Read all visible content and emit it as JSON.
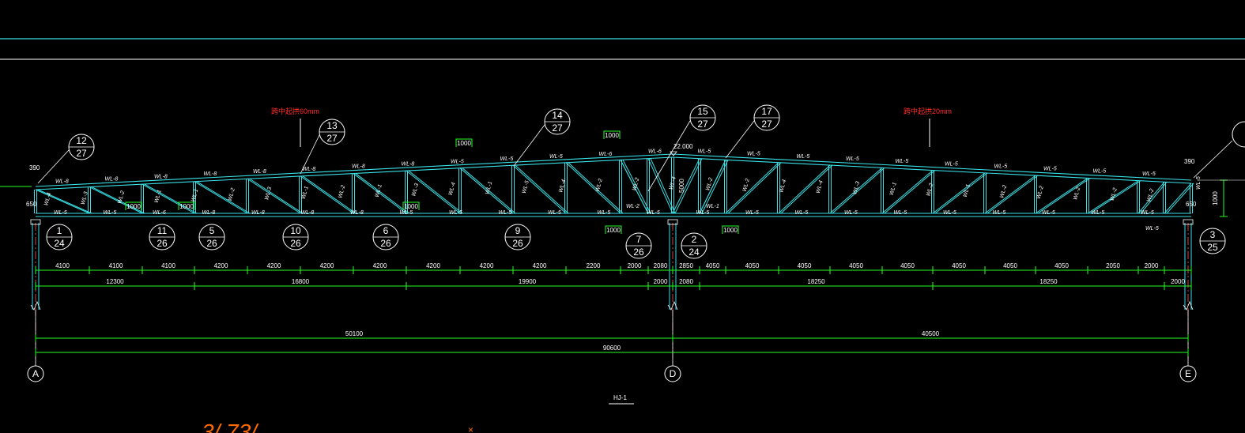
{
  "drawing": {
    "title": "HJ-1",
    "elevation_label": "22.000",
    "camber_left": "跨中起拱60mm",
    "camber_right": "跨中起拱20mm",
    "axis_labels": [
      "A",
      "D",
      "E"
    ],
    "height_left_top": "390",
    "height_left_bottom": "650",
    "height_right_top": "390",
    "height_right_bottom": "650",
    "height_right_total": "1000",
    "height_center": "5000",
    "sketch_text": "3/.73/"
  },
  "details": [
    {
      "num": "12",
      "sheet": "27"
    },
    {
      "num": "13",
      "sheet": "27"
    },
    {
      "num": "14",
      "sheet": "27"
    },
    {
      "num": "15",
      "sheet": "27"
    },
    {
      "num": "17",
      "sheet": "27"
    },
    {
      "num": "1",
      "sheet": "24"
    },
    {
      "num": "11",
      "sheet": "26"
    },
    {
      "num": "5",
      "sheet": "26"
    },
    {
      "num": "10",
      "sheet": "26"
    },
    {
      "num": "6",
      "sheet": "26"
    },
    {
      "num": "9",
      "sheet": "26"
    },
    {
      "num": "7",
      "sheet": "26"
    },
    {
      "num": "2",
      "sheet": "24"
    },
    {
      "num": "3",
      "sheet": "25"
    }
  ],
  "detail_tags": [
    "1000",
    "1000",
    "1000",
    "1000",
    "1000",
    "1000",
    "1000"
  ],
  "dims": {
    "row1": [
      "4100",
      "4100",
      "4100",
      "4200",
      "4200",
      "4200",
      "4200",
      "4200",
      "4200",
      "4200",
      "2200",
      "2000",
      "2080",
      "2850",
      "4050",
      "4050",
      "4050",
      "4050",
      "4050",
      "4050",
      "4050",
      "4050",
      "2050",
      "2000"
    ],
    "row2": [
      "12300",
      "16800",
      "19900",
      "2000",
      "2080",
      "18250",
      "18250",
      "2000"
    ],
    "row3": [
      "50100",
      "40500"
    ],
    "row4": [
      "90600"
    ]
  },
  "members": {
    "top": [
      "WL-8",
      "WL-8",
      "WL-8",
      "WL-8",
      "WL-8",
      "WL-8",
      "WL-8",
      "WL-8",
      "WL-5",
      "WL-5",
      "WL-5",
      "WL-6",
      "WL-6",
      "WL-5",
      "WL-5",
      "WL-5",
      "WL-5",
      "WL-5",
      "WL-5",
      "WL-5",
      "WL-5",
      "WL-5",
      "WL-5"
    ],
    "bottom": [
      "WL-5",
      "WL-5",
      "WL-6",
      "WL-8",
      "WL-8",
      "WL-8",
      "WL-8",
      "WL-5",
      "WL-5",
      "WL-5",
      "WL-5",
      "WL-5",
      "WL-5",
      "WL-5",
      "WL-5",
      "WL-5",
      "WL-5",
      "WL-5",
      "WL-5",
      "WL-5",
      "WL-5",
      "WL-5",
      "WL-5"
    ],
    "web": [
      "WL-4",
      "WL-3",
      "WL-2",
      "WL-1",
      "WL-1",
      "WL-2",
      "WL-3",
      "WL-1",
      "WL-2",
      "WL-1",
      "WL-3",
      "WL-4",
      "WL-1",
      "WL-5",
      "WL-4",
      "WL-2",
      "WL-2",
      "WL-4",
      "WL-2",
      "WL-2",
      "WL-4",
      "WL-4",
      "WL-3",
      "WL-1",
      "WL-2",
      "WL-1",
      "WL-2",
      "WL-2",
      "WL-2",
      "WL-2",
      "WL-2"
    ],
    "support_left": "WL-2",
    "support_center": "WL-1",
    "support_right": "WL-5",
    "right_vertical": "WL-5"
  },
  "colors": {
    "background": "#000000",
    "truss": "#38e1e6",
    "dimension": "#22ff22",
    "text": "#ffffff",
    "camber_note": "#ff2b2b",
    "sketch": "#ff6a00"
  }
}
